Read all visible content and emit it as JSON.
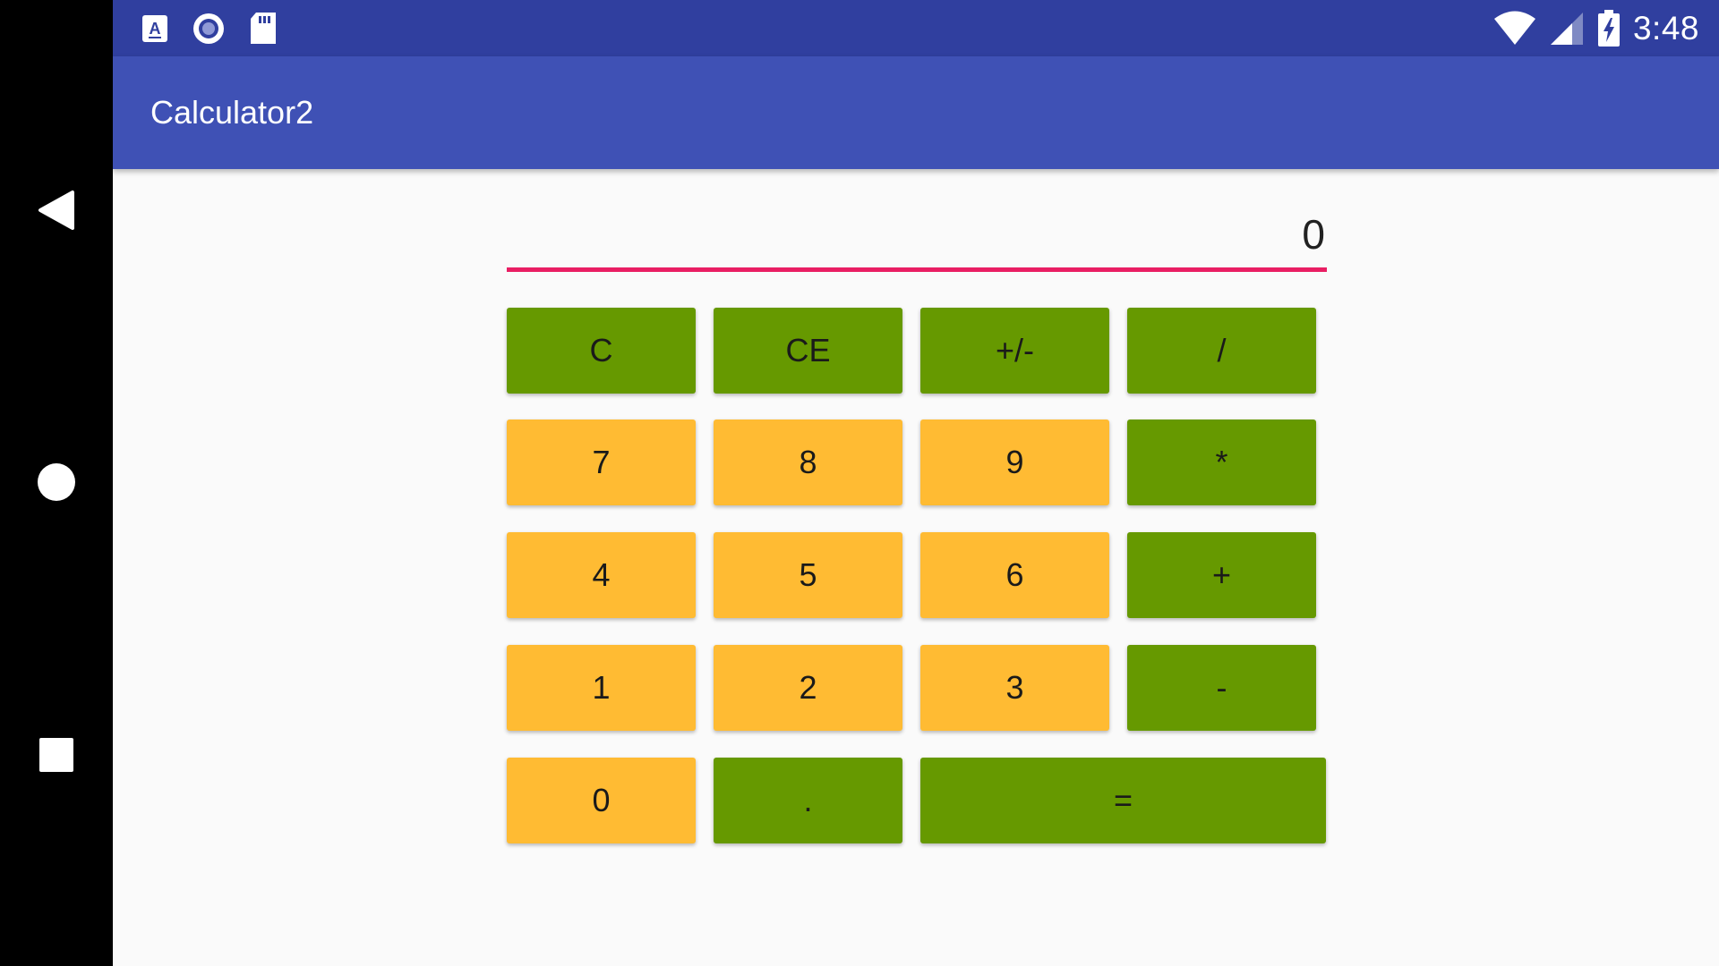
{
  "status_bar": {
    "time": "3:48",
    "left_icons": [
      "app-a-icon",
      "record-icon",
      "sd-card-icon"
    ],
    "right_icons": [
      "wifi-icon",
      "signal-icon",
      "battery-charging-icon"
    ]
  },
  "app_bar": {
    "title": "Calculator2"
  },
  "display": {
    "value": "0"
  },
  "colors": {
    "status_bar": "#303f9f",
    "app_bar": "#3f51b5",
    "display_underline": "#e91e63",
    "key_green": "#669900",
    "key_amber": "#ffbb33",
    "background": "#fafafa"
  },
  "keys": {
    "clear": "C",
    "clear_entry": "CE",
    "negate": "+/-",
    "divide": "/",
    "seven": "7",
    "eight": "8",
    "nine": "9",
    "multiply": "*",
    "four": "4",
    "five": "5",
    "six": "6",
    "add": "+",
    "one": "1",
    "two": "2",
    "three": "3",
    "subtract": "-",
    "zero": "0",
    "decimal": ".",
    "equals": "="
  },
  "nav_bar": {
    "buttons": [
      "back-icon",
      "home-icon",
      "recents-icon"
    ]
  }
}
